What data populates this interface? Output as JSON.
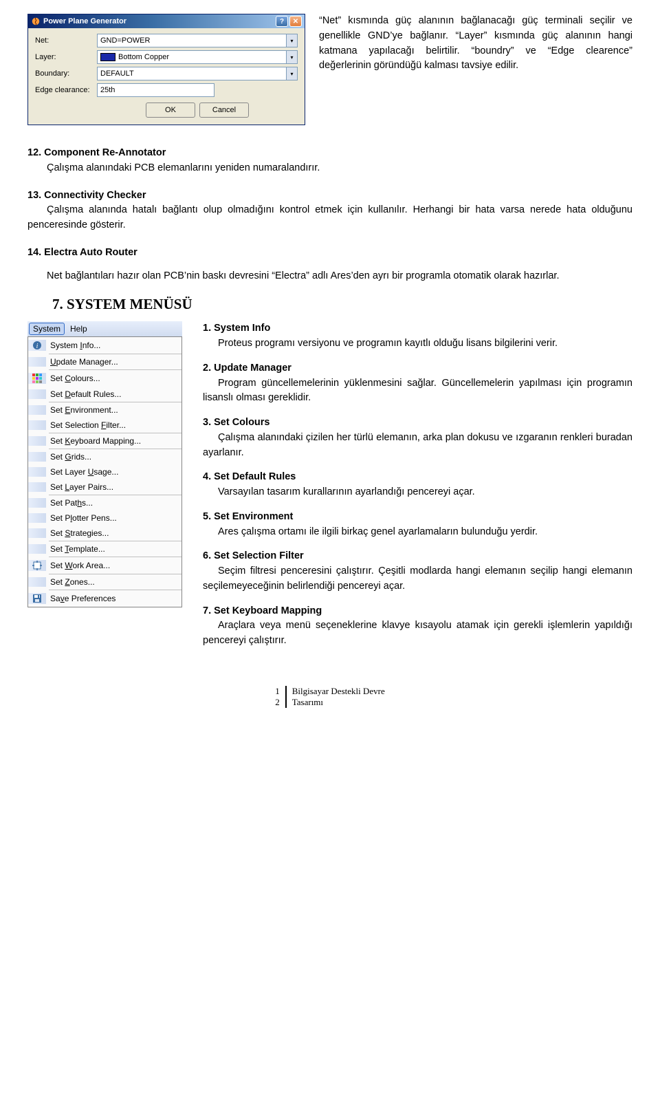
{
  "dialog": {
    "title": "Power Plane Generator",
    "fields": {
      "net_label": "Net:",
      "net_value": "GND=POWER",
      "layer_label": "Layer:",
      "layer_value": "Bottom Copper",
      "boundary_label": "Boundary:",
      "boundary_value": "DEFAULT",
      "edge_label": "Edge clearance:",
      "edge_value": "25th"
    },
    "ok": "OK",
    "cancel": "Cancel"
  },
  "top_text": "“Net” kısmında güç alanının bağlanacağı güç terminali seçilir ve genellikle GND’ye bağlanır. “Layer” kısmında güç alanının hangi katmana yapılacağı belirtilir. “boundry” ve “Edge clearence” değerlerinin göründüğü kalması tavsiye edilir.",
  "sections": [
    {
      "title": "12. Component Re-Annotator",
      "body": "Çalışma alanındaki PCB elemanlarını yeniden numaralandırır."
    },
    {
      "title": "13. Connectivity Checker",
      "body": "Çalışma alanında hatalı bağlantı olup olmadığını kontrol etmek için kullanılır. Herhangi bir hata varsa nerede hata olduğunu penceresinde gösterir."
    },
    {
      "title": "14. Electra Auto Router",
      "body": "Net bağlantıları hazır olan PCB’nin baskı devresini “Electra” adlı Ares’den ayrı bir programla otomatik olarak hazırlar."
    }
  ],
  "heading7": "7. SYSTEM MENÜSÜ",
  "menubar": {
    "system": "System",
    "help": "Help"
  },
  "menu_items": [
    {
      "label": "System Info...",
      "u": 7,
      "icon": "info"
    },
    {
      "sep": true
    },
    {
      "label": "Update Manager...",
      "u": 0
    },
    {
      "sep": true
    },
    {
      "label": "Set Colours...",
      "u": 4,
      "icon": "colours"
    },
    {
      "label": "Set Default Rules...",
      "u": 4
    },
    {
      "sep": true
    },
    {
      "label": "Set Environment...",
      "u": 4
    },
    {
      "label": "Set Selection Filter...",
      "u": 14
    },
    {
      "sep": true
    },
    {
      "label": "Set Keyboard Mapping...",
      "u": 4
    },
    {
      "sep": true
    },
    {
      "label": "Set Grids...",
      "u": 4
    },
    {
      "label": "Set Layer Usage...",
      "u": 10
    },
    {
      "label": "Set Layer Pairs...",
      "u": 4
    },
    {
      "sep": true
    },
    {
      "label": "Set Paths...",
      "u": 7
    },
    {
      "label": "Set Plotter Pens...",
      "u": 5
    },
    {
      "label": "Set Strategies...",
      "u": 4
    },
    {
      "sep": true
    },
    {
      "label": "Set Template...",
      "u": 4
    },
    {
      "sep": true
    },
    {
      "label": "Set Work Area...",
      "u": 4,
      "icon": "work"
    },
    {
      "sep": true
    },
    {
      "label": "Set Zones...",
      "u": 4
    },
    {
      "sep": true
    },
    {
      "label": "Save Preferences",
      "u": 2,
      "icon": "save"
    }
  ],
  "right_blocks": [
    {
      "title": "1. System Info",
      "body": "Proteus programı versiyonu ve programın kayıtlı olduğu lisans bilgilerini verir."
    },
    {
      "title": "2. Update Manager",
      "body": "Program güncellemelerinin yüklenmesini sağlar. Güncellemelerin yapılması için programın lisanslı olması gereklidir."
    },
    {
      "title": "3. Set Colours",
      "body": "Çalışma alanındaki çizilen her türlü elemanın, arka plan dokusu ve ızgaranın renkleri buradan ayarlanır."
    },
    {
      "title": "4. Set Default Rules",
      "body": "Varsayılan tasarım kurallarının ayarlandığı pencereyi açar."
    },
    {
      "title": "5. Set Environment",
      "body": "Ares çalışma ortamı ile ilgili birkaç genel ayarlamaların bulunduğu yerdir."
    },
    {
      "title": "6. Set Selection Filter",
      "body": "Seçim filtresi penceresini çalıştırır. Çeşitli modlarda hangi elemanın seçilip hangi elemanın seçilemeyeceğinin belirlendiği pencereyi açar."
    },
    {
      "title": "7. Set Keyboard Mapping",
      "body": "Araçlara veya menü seçeneklerine klavye kısayolu atamak için gerekli işlemlerin yapıldığı pencereyi çalıştırır."
    }
  ],
  "footer": {
    "n1": "1",
    "n2": "2",
    "l1": "Bilgisayar Destekli Devre",
    "l2": "Tasarımı"
  }
}
